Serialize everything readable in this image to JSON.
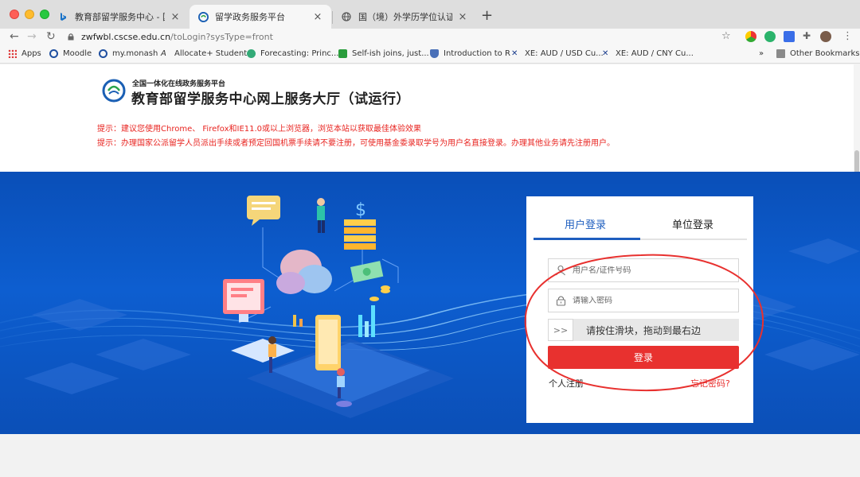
{
  "browser": {
    "tabs": [
      {
        "title": "教育部留学服务中心 - 国内版 Bi",
        "favicon": "bing-icon"
      },
      {
        "title": "留学政务服务平台",
        "favicon": "cscse-icon"
      },
      {
        "title": "国（境）外学历学位认证申请材",
        "favicon": "globe-icon"
      }
    ],
    "url_host": "zwfwbl.cscse.edu.cn",
    "url_path": "/toLogin?sysType=front",
    "bookmarks": [
      {
        "label": "Apps",
        "icon": "apps-icon"
      },
      {
        "label": "Moodle",
        "icon": "moodle-icon"
      },
      {
        "label": "my.monash",
        "icon": "monash-icon"
      },
      {
        "label": "Allocate+ Student",
        "icon": "allocate-icon"
      },
      {
        "label": "Forecasting: Princ...",
        "icon": "forecasting-icon"
      },
      {
        "label": "Self-ish joins, just...",
        "icon": "selfish-icon"
      },
      {
        "label": "Introduction to R",
        "icon": "shield-icon"
      },
      {
        "label": "XE: AUD / USD Cu...",
        "icon": "xe-icon"
      },
      {
        "label": "XE: AUD / CNY Cu...",
        "icon": "xe-icon"
      },
      {
        "label": "Other Bookmarks",
        "icon": "folder-icon"
      }
    ],
    "overflow": "»"
  },
  "site": {
    "subtitle": "全国一体化在线政务服务平台",
    "title": "教育部留学服务中心网上服务大厅（试运行）",
    "tips": [
      "提示：建议您使用Chrome、 Firefox和IE11.0或以上浏览器，浏览本站以获取最佳体验效果",
      "提示：办理国家公派留学人员派出手续或者预定回国机票手续请不要注册，可使用基金委录取学号为用户名直接登录。办理其他业务请先注册用户。"
    ]
  },
  "login": {
    "tab_user": "用户登录",
    "tab_unit": "单位登录",
    "username_placeholder": "用户名/证件号码",
    "password_placeholder": "请输入密码",
    "slider_text": "请按住滑块，拖动到最右边",
    "slider_handle": ">>",
    "login_button": "登录",
    "register_link": "个人注册",
    "forgot_link": "忘记密码?"
  },
  "colors": {
    "accent_blue": "#1e5ebf",
    "login_red": "#e8312f",
    "tip_red": "#e8231f",
    "banner_blue": "#0d5ed0"
  }
}
